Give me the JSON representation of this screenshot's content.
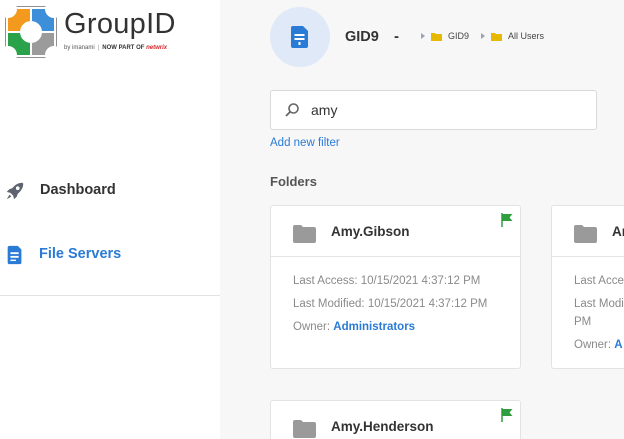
{
  "brand": {
    "name": "GroupID",
    "tagline_by": "by imanami",
    "tagline_now": "NOW PART OF",
    "tagline_partner": "netwrix"
  },
  "nav": {
    "items": [
      {
        "label": "Dashboard",
        "icon": "rocket-icon",
        "active": false
      },
      {
        "label": "File Servers",
        "icon": "file-server-icon",
        "active": true
      }
    ]
  },
  "header": {
    "server_name": "GID9",
    "separator": "-",
    "breadcrumb": [
      "GID9",
      "All Users"
    ]
  },
  "search": {
    "value": "amy",
    "placeholder": ""
  },
  "filters": {
    "add_label": "Add new filter"
  },
  "folders": {
    "section_title": "Folders",
    "access_label": "Last Access:",
    "modified_label": "Last Modified:",
    "owner_label": "Owner:",
    "items": [
      {
        "name": "Amy.Gibson",
        "last_access": "10/15/2021 4:37:12 PM",
        "last_modified": "10/15/2021 4:37:12 PM",
        "owner": "Administrators"
      },
      {
        "name": "Ar",
        "last_access": "",
        "last_modified": "",
        "owner": "A"
      },
      {
        "name": "Amy.Henderson",
        "last_access": "",
        "last_modified": "",
        "owner": ""
      }
    ]
  },
  "colors": {
    "accent": "#2a7bd6",
    "flag": "#2e9e3f",
    "folder_yellow": "#e6b800",
    "folder_grey": "#9a9a9a",
    "badge_bg": "#dfe9f7"
  }
}
